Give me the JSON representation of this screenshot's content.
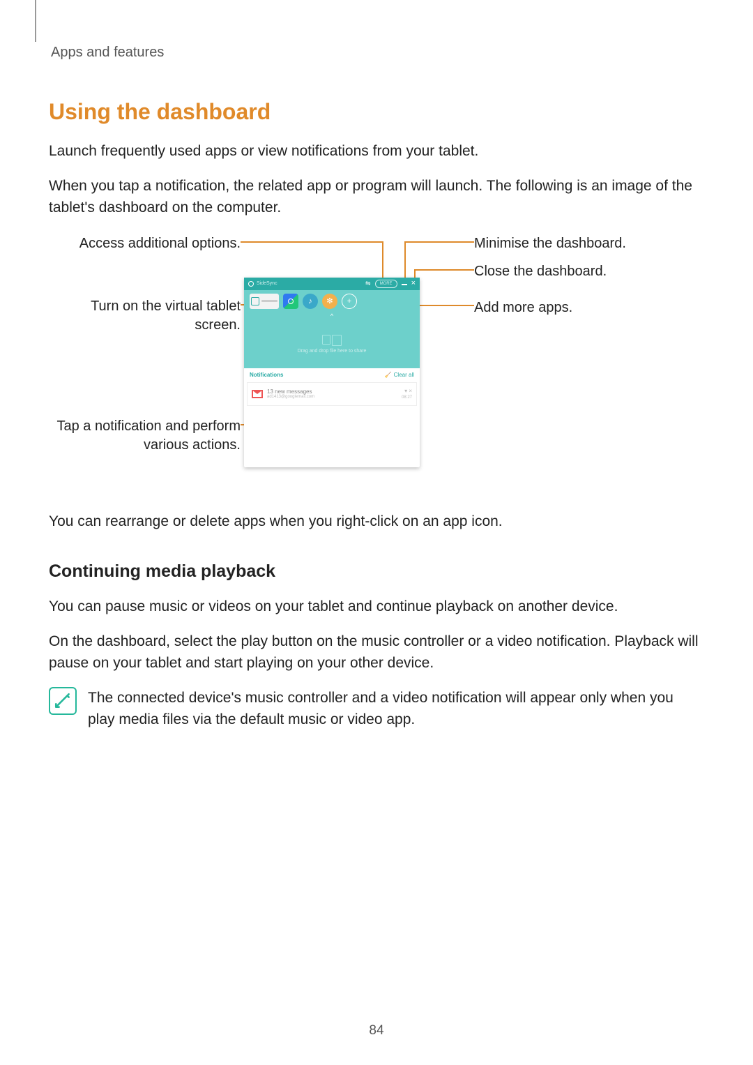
{
  "breadcrumb": "Apps and features",
  "headings": {
    "h1": "Using the dashboard",
    "h2": "Continuing media playback"
  },
  "paragraphs": {
    "p1": "Launch frequently used apps or view notifications from your tablet.",
    "p2": "When you tap a notification, the related app or program will launch. The following is an image of the tablet's dashboard on the computer.",
    "p3": "You can rearrange or delete apps when you right-click on an app icon.",
    "p4": "You can pause music or videos on your tablet and continue playback on another device.",
    "p5": "On the dashboard, select the play button on the music controller or a video notification. Playback will pause on your tablet and start playing on your other device.",
    "note": "The connected device's music controller and a video notification will appear only when you play media files via the default music or video app."
  },
  "callouts": {
    "left1": "Access additional options.",
    "left2a": "Turn on the virtual tablet",
    "left2b": "screen.",
    "left3a": "Tap a notification and perform",
    "left3b": "various actions.",
    "right1": "Minimise the dashboard.",
    "right2": "Close the dashboard.",
    "right3": "Add more apps."
  },
  "dashboard": {
    "title": "SideSync",
    "more": "MORE",
    "drop_text": "Drag and drop file here to share",
    "notif_header": "Notifications",
    "clear_all": "Clear all",
    "notif_title": "13 new messages",
    "notif_sub": "ad1413@googlemail.com",
    "notif_time": "08:27",
    "caret": "^"
  },
  "page_number": "84"
}
